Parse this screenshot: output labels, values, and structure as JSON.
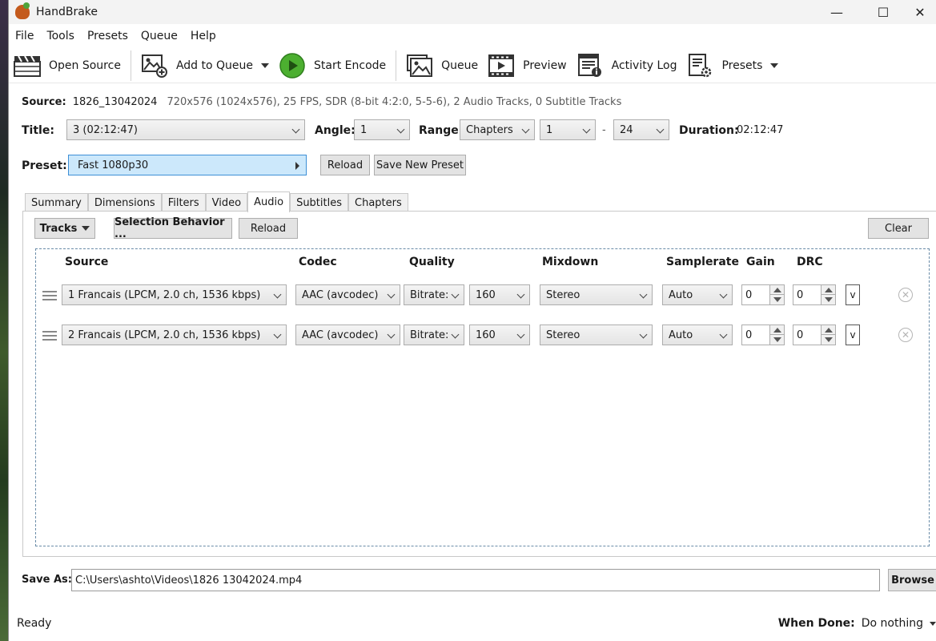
{
  "app": {
    "title": "HandBrake"
  },
  "window_controls": {
    "minimize": "—",
    "maximize": "☐",
    "close": "✕"
  },
  "menu": [
    "File",
    "Tools",
    "Presets",
    "Queue",
    "Help"
  ],
  "toolbar": {
    "open_source": "Open Source",
    "add_to_queue": "Add to Queue",
    "start_encode": "Start Encode",
    "queue": "Queue",
    "preview": "Preview",
    "activity_log": "Activity Log",
    "presets": "Presets"
  },
  "source": {
    "label": "Source:",
    "name": "1826_13042024",
    "info": "720x576 (1024x576), 25 FPS, SDR (8-bit 4:2:0, 5-5-6), 2 Audio Tracks, 0 Subtitle Tracks"
  },
  "title_row": {
    "title_label": "Title:",
    "title_value": "3  (02:12:47)",
    "angle_label": "Angle:",
    "angle_value": "1",
    "range_label": "Range:",
    "range_type": "Chapters",
    "range_start": "1",
    "range_sep": "-",
    "range_end": "24",
    "duration_label": "Duration:",
    "duration_value": "02:12:47"
  },
  "preset_row": {
    "label": "Preset:",
    "value": "Fast 1080p30",
    "reload": "Reload",
    "save_new": "Save New Preset"
  },
  "tabs": [
    "Summary",
    "Dimensions",
    "Filters",
    "Video",
    "Audio",
    "Subtitles",
    "Chapters"
  ],
  "active_tab": "Audio",
  "audio": {
    "tracks_btn": "Tracks",
    "selection_behavior_btn": "Selection Behavior ...",
    "reload_btn": "Reload",
    "clear_btn": "Clear",
    "columns": {
      "source": "Source",
      "codec": "Codec",
      "quality": "Quality",
      "mixdown": "Mixdown",
      "samplerate": "Samplerate",
      "gain": "Gain",
      "drc": "DRC"
    },
    "rows": [
      {
        "source": "1 Francais (LPCM, 2.0 ch, 1536 kbps)",
        "codec": "AAC (avcodec)",
        "quality_mode": "Bitrate:",
        "bitrate": "160",
        "mixdown": "Stereo",
        "samplerate": "Auto",
        "gain": "0",
        "drc": "0",
        "extra": "v"
      },
      {
        "source": "2 Francais (LPCM, 2.0 ch, 1536 kbps)",
        "codec": "AAC (avcodec)",
        "quality_mode": "Bitrate:",
        "bitrate": "160",
        "mixdown": "Stereo",
        "samplerate": "Auto",
        "gain": "0",
        "drc": "0",
        "extra": "v"
      }
    ]
  },
  "save_as": {
    "label": "Save As:",
    "path": "C:\\Users\\ashto\\Videos\\1826 13042024.mp4",
    "browse": "Browse"
  },
  "status": {
    "text": "Ready",
    "when_done_label": "When Done:",
    "when_done_value": "Do nothing"
  },
  "colors": {
    "preset_bg": "#cce8fb",
    "preset_border": "#3d8fd6",
    "play_green": "#4caf30"
  }
}
